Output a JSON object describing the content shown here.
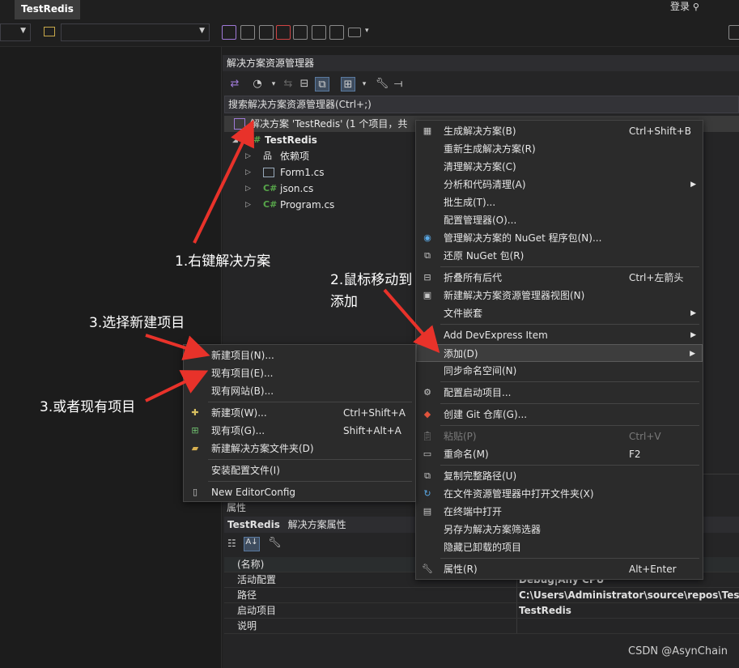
{
  "app": {
    "tab": "TestRedis",
    "login": "登录"
  },
  "solution_explorer": {
    "title": "解决方案资源管理器",
    "search_placeholder": "搜索解决方案资源管理器(Ctrl+;)",
    "solution_label": "解决方案 'TestRedis' (1 个项目，共",
    "tree": [
      {
        "label": "TestRedis",
        "icon": "csharp-project-icon"
      },
      {
        "label": "依赖项",
        "icon": "dependencies-icon"
      },
      {
        "label": "Form1.cs",
        "icon": "form-icon"
      },
      {
        "label": "json.cs",
        "icon": "csharp-file-icon"
      },
      {
        "label": "Program.cs",
        "icon": "csharp-file-icon"
      }
    ]
  },
  "solution_menu": [
    {
      "label": "生成解决方案(B)",
      "shortcut": "Ctrl+Shift+B",
      "icon": "build-icon"
    },
    {
      "label": "重新生成解决方案(R)"
    },
    {
      "label": "清理解决方案(C)"
    },
    {
      "label": "分析和代码清理(A)",
      "submenu": true
    },
    {
      "label": "批生成(T)..."
    },
    {
      "label": "配置管理器(O)..."
    },
    {
      "label": "管理解决方案的 NuGet 程序包(N)...",
      "icon": "nuget-icon"
    },
    {
      "label": "还原 NuGet 包(R)",
      "icon": "restore-icon"
    },
    {
      "label": "折叠所有后代",
      "shortcut": "Ctrl+左箭头",
      "icon": "collapse-icon"
    },
    {
      "label": "新建解决方案资源管理器视图(N)",
      "icon": "new-view-icon"
    },
    {
      "label": "文件嵌套",
      "submenu": true
    },
    {
      "label": "Add DevExpress Item",
      "submenu": true
    },
    {
      "label": "添加(D)",
      "submenu": true
    },
    {
      "label": "同步命名空间(N)"
    },
    {
      "label": "配置启动项目...",
      "icon": "gear-icon"
    },
    {
      "label": "创建 Git 仓库(G)...",
      "icon": "git-icon"
    },
    {
      "label": "粘贴(P)",
      "shortcut": "Ctrl+V",
      "icon": "paste-icon"
    },
    {
      "label": "重命名(M)",
      "shortcut": "F2",
      "icon": "rename-icon"
    },
    {
      "label": "复制完整路径(U)",
      "icon": "copy-icon"
    },
    {
      "label": "在文件资源管理器中打开文件夹(X)",
      "icon": "open-folder-icon"
    },
    {
      "label": "在终端中打开",
      "icon": "terminal-icon"
    },
    {
      "label": "另存为解决方案筛选器"
    },
    {
      "label": "隐藏已卸载的项目"
    },
    {
      "label": "属性(R)",
      "shortcut": "Alt+Enter",
      "icon": "wrench-icon"
    }
  ],
  "add_menu": [
    {
      "label": "新建项目(N)..."
    },
    {
      "label": "现有项目(E)..."
    },
    {
      "label": "现有网站(B)..."
    },
    {
      "label": "新建项(W)...",
      "shortcut": "Ctrl+Shift+A",
      "icon": "new-item-icon"
    },
    {
      "label": "现有项(G)...",
      "shortcut": "Shift+Alt+A",
      "icon": "existing-item-icon"
    },
    {
      "label": "新建解决方案文件夹(D)",
      "icon": "new-folder-icon"
    },
    {
      "label": "安装配置文件(I)"
    },
    {
      "label": "New EditorConfig",
      "icon": "file-icon"
    }
  ],
  "properties": {
    "section_label": "属性",
    "header_name": "TestRedis",
    "header_suffix": "解决方案属性",
    "rows": [
      {
        "key": "(名称)",
        "value": ""
      },
      {
        "key": "活动配置",
        "value": "Debug|Any CPU"
      },
      {
        "key": "路径",
        "value": "C:\\Users\\Administrator\\source\\repos\\TestRe"
      },
      {
        "key": "启动项目",
        "value": "TestRedis"
      },
      {
        "key": "说明",
        "value": ""
      }
    ]
  },
  "annotations": {
    "a1": "1.右键解决方案",
    "a2_line1": "2.鼠标移动到",
    "a2_line2": "添加",
    "a3": "3.选择新建项目",
    "a4": "3.或者现有项目"
  },
  "watermark": "CSDN @AsynChain",
  "colors": {
    "arrow": "#e8322a",
    "menu_bg": "#2b2b2b",
    "panel_bg": "#252526"
  }
}
